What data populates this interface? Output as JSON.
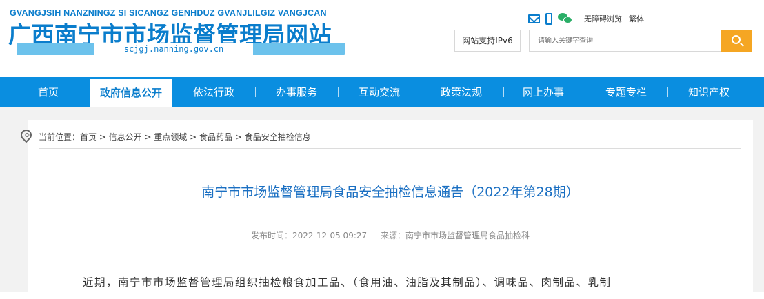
{
  "header": {
    "logo_pinyin": "GVANGJSIH NANZNINGZ SI SICANGZ GENHDUZ GVANJLILGIZ VANGJCAN",
    "logo_title": "广西南宁市市场监督管理局网站",
    "logo_domain": "scjgj.nanning.gov.cn",
    "top_links": {
      "accessibility": "无障碍浏览",
      "traditional": "繁体"
    },
    "icons": [
      "mail-icon",
      "phone-icon",
      "wechat-icon"
    ],
    "ipv6": "网站支持IPv6",
    "search_placeholder": "请输入关键字查询",
    "search_color": "#f5a623"
  },
  "nav": {
    "items": [
      {
        "label": "首页"
      },
      {
        "label": "政府信息公开"
      },
      {
        "label": "依法行政"
      },
      {
        "label": "办事服务"
      },
      {
        "label": "互动交流"
      },
      {
        "label": "政策法规"
      },
      {
        "label": "网上办事"
      },
      {
        "label": "专题专栏"
      },
      {
        "label": "知识产权"
      }
    ],
    "active": "政府信息公开",
    "bg_color": "#0a8ee0"
  },
  "breadcrumb": {
    "text": "当前位置：首页 > 信息公开 > 重点领域 > 食品药品 > 食品安全抽检信息"
  },
  "article": {
    "title": "南宁市市场监督管理局食品安全抽检信息通告（2022年第28期）",
    "publish_time": "发布时间：2022-12-05 09:27",
    "source": "来源：南宁市市场监督管理局食品抽检科",
    "body_first_line": "近期，南宁市市场监督管理局组织抽检粮食加工品、（食用油、油脂及其制品）、调味品、肉制品、乳制"
  }
}
